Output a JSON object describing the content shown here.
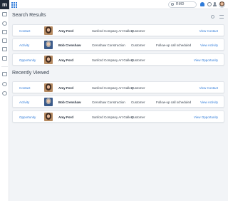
{
  "topbar": {
    "logo_text": "m",
    "search_value": "RMD"
  },
  "search_results": {
    "title": "Search Results",
    "rows": [
      {
        "type": "Contact",
        "name": "Amy Ford",
        "company": "Sanford Company Art Gallery",
        "role": "Customer",
        "note": "",
        "action": "View Contact",
        "photo": "amy"
      },
      {
        "type": "Activity",
        "name": "Bob Crenshaw",
        "company": "Crenshaw Construction",
        "role": "Customer",
        "note": "Follow-up call scheduled",
        "action": "View Activity",
        "photo": "bob"
      },
      {
        "type": "Opportunity",
        "name": "Amy Ford",
        "company": "Sanford Company Art Gallery",
        "role": "Customer",
        "note": "",
        "action": "View Opportunity",
        "photo": "amy"
      }
    ]
  },
  "recently_viewed": {
    "title": "Recently Viewed",
    "rows": [
      {
        "type": "Contact",
        "name": "Amy Ford",
        "company": "Sanford Company Art Gallery",
        "role": "Customer",
        "note": "",
        "action": "View Contact",
        "photo": "amy"
      },
      {
        "type": "Activity",
        "name": "Bob Crenshaw",
        "company": "Crenshaw Construction",
        "role": "Customer",
        "note": "Follow-up call scheduled",
        "action": "View Activity",
        "photo": "bob"
      },
      {
        "type": "Opportunity",
        "name": "Amy Ford",
        "company": "Sanford Company Art Gallery",
        "role": "Customer",
        "note": "",
        "action": "View Opportunity",
        "photo": "amy"
      }
    ]
  },
  "colors": {
    "accent": "#2f7bd9",
    "background": "#f2f4f7"
  }
}
